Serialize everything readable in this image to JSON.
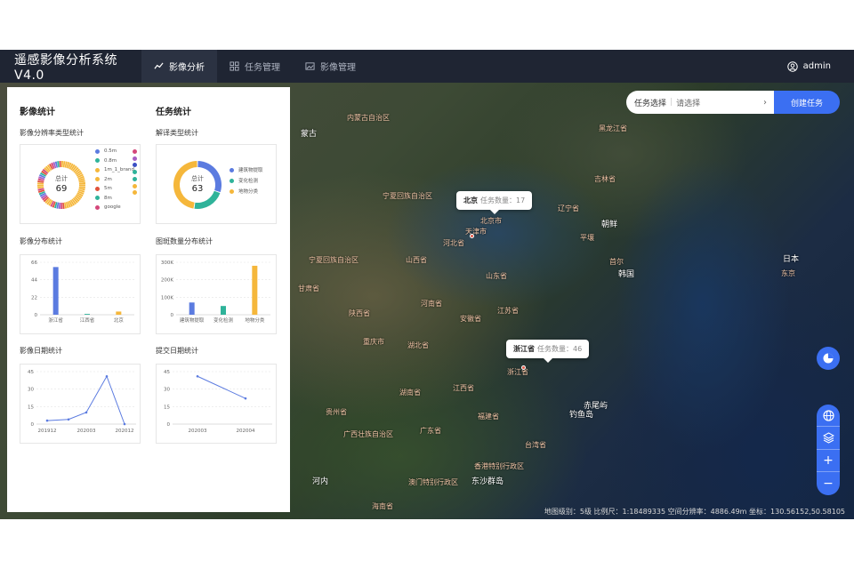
{
  "app": {
    "title": "遥感影像分析系统V4.0",
    "user": "admin"
  },
  "nav": [
    {
      "label": "影像分析",
      "icon": "chart-line-icon",
      "active": true
    },
    {
      "label": "任务管理",
      "icon": "grid-icon",
      "active": false
    },
    {
      "label": "影像管理",
      "icon": "image-icon",
      "active": false
    }
  ],
  "search": {
    "label": "任务选择",
    "placeholder": "请选择",
    "create_label": "创建任务"
  },
  "tooltips": [
    {
      "name": "北京",
      "text": "任务数量：17"
    },
    {
      "name": "浙江省",
      "text": "任务数量：46"
    }
  ],
  "map": {
    "labels": [
      {
        "text": "内蒙古自治区"
      },
      {
        "text": "蒙古"
      },
      {
        "text": "黑龙江省"
      },
      {
        "text": "吉林省"
      },
      {
        "text": "辽宁省"
      },
      {
        "text": "朝鲜"
      },
      {
        "text": "平壤"
      },
      {
        "text": "首尔"
      },
      {
        "text": "韩国"
      },
      {
        "text": "日本"
      },
      {
        "text": "东京"
      },
      {
        "text": "宁夏回族自治区"
      },
      {
        "text": "北京市"
      },
      {
        "text": "天津市"
      },
      {
        "text": "河北省"
      },
      {
        "text": "山西省"
      },
      {
        "text": "山东省"
      },
      {
        "text": "宁夏回族自治区"
      },
      {
        "text": "甘肃省"
      },
      {
        "text": "河南省"
      },
      {
        "text": "陕西省"
      },
      {
        "text": "江苏省"
      },
      {
        "text": "安徽省"
      },
      {
        "text": "湖北省"
      },
      {
        "text": "重庆市"
      },
      {
        "text": "浙江省"
      },
      {
        "text": "湖南省"
      },
      {
        "text": "江西省"
      },
      {
        "text": "贵州省"
      },
      {
        "text": "福建省"
      },
      {
        "text": "赤尾屿"
      },
      {
        "text": "钓鱼岛"
      },
      {
        "text": "台湾省"
      },
      {
        "text": "广西壮族自治区"
      },
      {
        "text": "广东省"
      },
      {
        "text": "香港特别行政区"
      },
      {
        "text": "澳门特别行政区"
      },
      {
        "text": "东沙群岛"
      },
      {
        "text": "河内"
      },
      {
        "text": "海南省"
      }
    ],
    "status": "地图级别：5级   比例尺：1:18489335   空间分辨率：4886.49m   坐标：130.56152,50.58105"
  },
  "panel": {
    "left_title": "影像统计",
    "right_title": "任务统计",
    "sections": {
      "res_type": "影像分辨率类型统计",
      "interp_type": "解译类型统计",
      "img_dist": "影像分布统计",
      "patch_dist": "图斑数量分布统计",
      "img_date": "影像日期统计",
      "submit_date": "提交日期统计"
    }
  },
  "colors": {
    "accent": "#3b6ff2",
    "header": "#1f2533",
    "blue": "#5b7be0",
    "green": "#2fb39a",
    "orange": "#f5b73b"
  },
  "chart_data": [
    {
      "type": "pie",
      "title": "影像分辨率类型统计",
      "center_label": "总计",
      "total": "69",
      "legend": [
        "0.5m",
        "0.8m",
        "1m_1_brand",
        "2m",
        "5m",
        "8m",
        "google"
      ],
      "legend_colors": [
        "#5b7be0",
        "#2fb39a",
        "#f5b73b",
        "#f5b73b",
        "#e0523a",
        "#2fb39a",
        "#d4477a"
      ],
      "extra_legend_colors": [
        "#d4477a",
        "#a65dc4",
        "#3b4fc4",
        "#2fb39a",
        "#2fb39a",
        "#f5b73b",
        "#f5b73b"
      ],
      "values": [
        69
      ]
    },
    {
      "type": "pie",
      "title": "解译类型统计",
      "center_label": "总计",
      "total": "63",
      "categories": [
        "建筑物提取",
        "变化检测",
        "地物分类"
      ],
      "colors": [
        "#5b7be0",
        "#2fb39a",
        "#f5b73b"
      ],
      "values": [
        19,
        14,
        30
      ]
    },
    {
      "type": "bar",
      "title": "影像分布统计",
      "categories": [
        "浙江省",
        "江西省",
        "北京"
      ],
      "values": [
        60,
        1,
        4
      ],
      "colors": [
        "#5b7be0",
        "#2fb39a",
        "#f5b73b"
      ],
      "yticks": [
        "0",
        "22",
        "44",
        "66"
      ],
      "ylim": [
        0,
        66
      ]
    },
    {
      "type": "bar",
      "title": "图斑数量分布统计",
      "categories": [
        "建筑物提取",
        "变化检测",
        "地物分类"
      ],
      "values": [
        70000,
        50000,
        280000
      ],
      "colors": [
        "#5b7be0",
        "#2fb39a",
        "#f5b73b"
      ],
      "yticks": [
        "0",
        "100K",
        "200K",
        "300K"
      ],
      "ylim": [
        0,
        300000
      ]
    },
    {
      "type": "line",
      "title": "影像日期统计",
      "x": [
        "201912",
        "202001",
        "202002",
        "202003",
        "202012"
      ],
      "xticks": [
        "201912",
        "202003",
        "202012"
      ],
      "values": [
        3,
        4,
        10,
        41,
        0
      ],
      "yticks": [
        "0",
        "15",
        "30",
        "45"
      ],
      "ylim": [
        0,
        45
      ]
    },
    {
      "type": "line",
      "title": "提交日期统计",
      "x": [
        "202003",
        "202004"
      ],
      "xticks": [
        "202003",
        "202004"
      ],
      "values": [
        41,
        22
      ],
      "yticks": [
        "0",
        "15",
        "30",
        "45"
      ],
      "ylim": [
        0,
        45
      ]
    }
  ]
}
